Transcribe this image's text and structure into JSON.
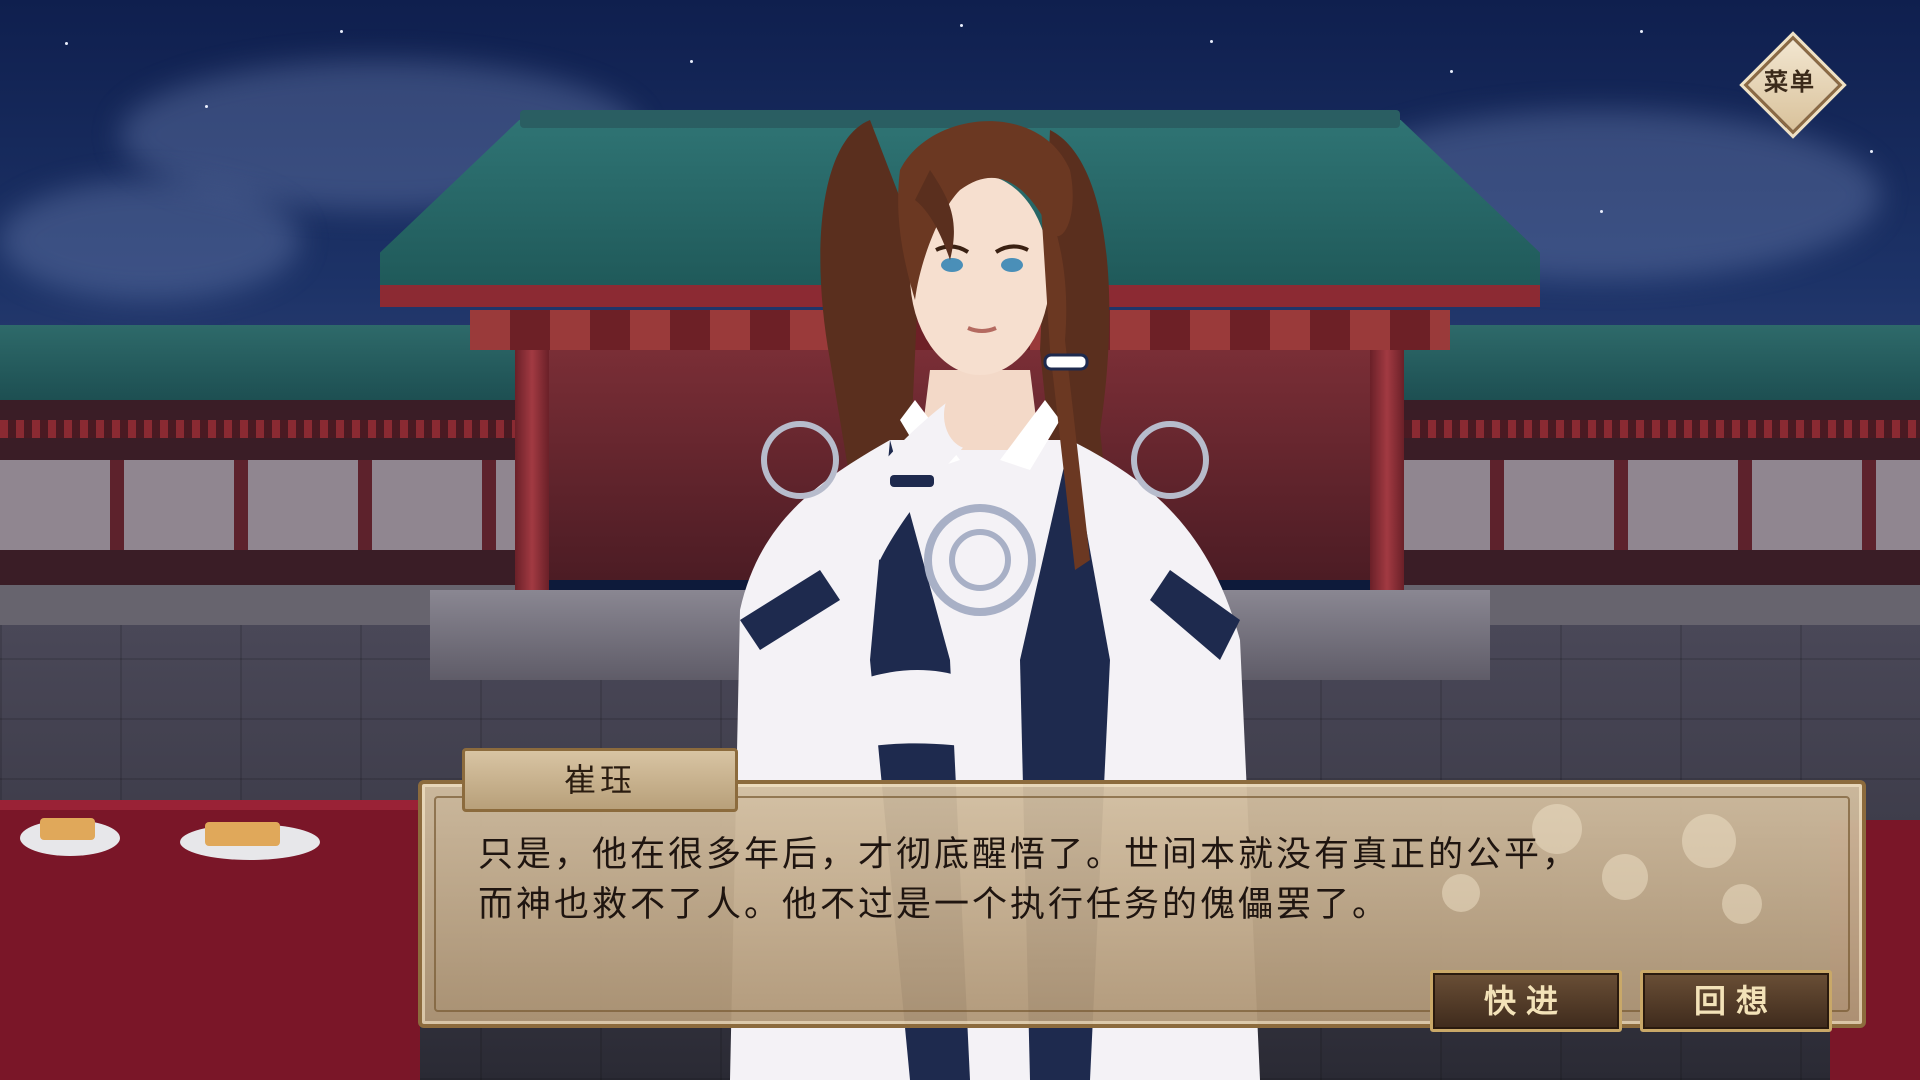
{
  "menu": {
    "label": "菜单"
  },
  "dialog": {
    "speaker": "崔珏",
    "lines": [
      "只是，他在很多年后，才彻底醒悟了。世间本就没有真正的公平，",
      "而神也救不了人。他不过是一个执行任务的傀儡罢了。"
    ]
  },
  "controls": {
    "fast_forward_label": "快进",
    "backlog_label": "回想"
  },
  "icons": {
    "menu": "diamond-menu-icon"
  },
  "colors": {
    "accent": "#c9a868",
    "dialog_bg": "#c8b28e",
    "sky": "#0f1f4e"
  }
}
